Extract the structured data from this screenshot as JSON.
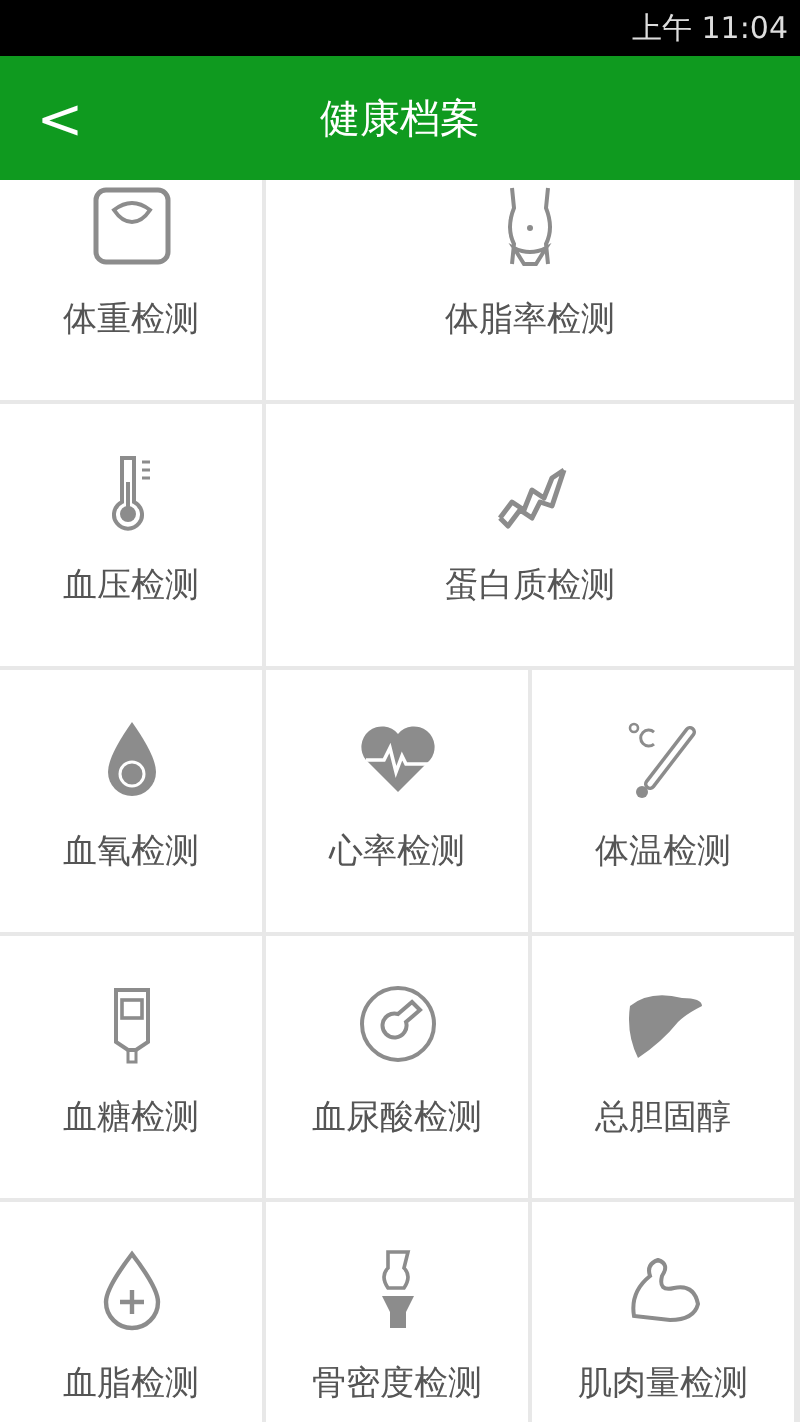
{
  "status_bar": {
    "time": "上午 11:04"
  },
  "header": {
    "back": "<",
    "title": "健康档案"
  },
  "tiles": [
    {
      "label": "体重检测",
      "wide": false
    },
    {
      "label": "体脂率检测",
      "wide": true
    },
    {
      "label": "血压检测",
      "wide": false
    },
    {
      "label": "蛋白质检测",
      "wide": true
    },
    {
      "label": "血氧检测",
      "wide": false
    },
    {
      "label": "心率检测",
      "wide": false
    },
    {
      "label": "体温检测",
      "wide": false
    },
    {
      "label": "血糖检测",
      "wide": false
    },
    {
      "label": "血尿酸检测",
      "wide": false
    },
    {
      "label": "总胆固醇",
      "wide": false
    },
    {
      "label": "血脂检测",
      "wide": false
    },
    {
      "label": "骨密度检测",
      "wide": false
    },
    {
      "label": "肌肉量检测",
      "wide": false
    }
  ]
}
